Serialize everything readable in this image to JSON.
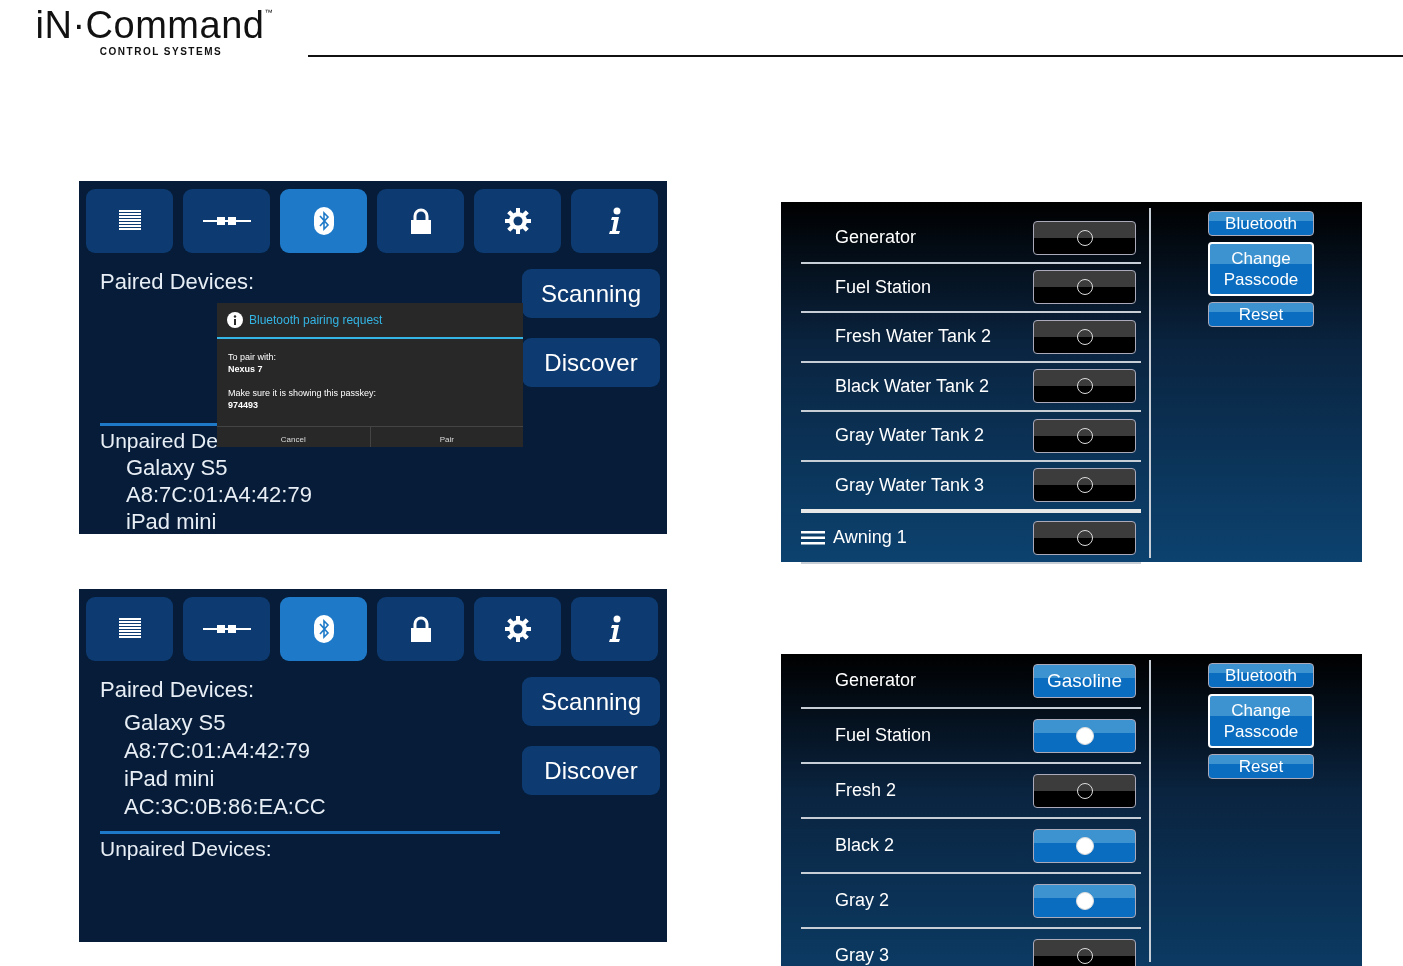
{
  "logo": {
    "wordmark": "iN·Command",
    "trademark": "™",
    "tagline": "CONTROL SYSTEMS"
  },
  "bt_screens": [
    {
      "tabs": [
        {
          "selected": false
        },
        {
          "selected": false
        },
        {
          "selected": true
        },
        {
          "selected": false
        },
        {
          "selected": false
        },
        {
          "selected": false
        }
      ],
      "paired_heading": "Paired Devices:",
      "unpaired_heading": "Unpaired De",
      "unpaired": [
        "Galaxy S5",
        "A8:7C:01:A4:42:79",
        "iPad mini"
      ],
      "buttons": [
        "Scanning",
        "Discover"
      ],
      "dialog": {
        "title": "Bluetooth pairing request",
        "paragraphs": [
          [
            {
              "text": "To pair with:",
              "bold": false
            },
            {
              "text": "Nexus 7",
              "bold": true
            }
          ],
          [
            {
              "text": "Make sure it is showing this passkey:",
              "bold": false
            },
            {
              "text": "974493",
              "bold": true
            }
          ]
        ],
        "buttons": [
          "Cancel",
          "Pair"
        ]
      }
    },
    {
      "tabs": [
        {
          "selected": false
        },
        {
          "selected": false
        },
        {
          "selected": true
        },
        {
          "selected": false
        },
        {
          "selected": false
        },
        {
          "selected": false
        }
      ],
      "paired_heading": "Paired Devices:",
      "paired": [
        "Galaxy S5",
        "A8:7C:01:A4:42:79",
        "iPad mini",
        "AC:3C:0B:86:EA:CC"
      ],
      "unpaired_heading": "Unpaired Devices:",
      "buttons": [
        "Scanning",
        "Discover"
      ]
    }
  ],
  "device_panels": [
    {
      "rows": [
        {
          "label": "Generator",
          "kind": "toggle",
          "on": false
        },
        {
          "label": "Fuel Station",
          "kind": "toggle",
          "on": false
        },
        {
          "label": "Fresh Water Tank 2",
          "kind": "toggle",
          "on": false
        },
        {
          "label": "Black Water Tank 2",
          "kind": "toggle",
          "on": false
        },
        {
          "label": "Gray Water Tank 2",
          "kind": "toggle",
          "on": false
        },
        {
          "label": "Gray Water Tank 3",
          "kind": "toggle",
          "on": false
        },
        {
          "label": "Awning 1",
          "kind": "toggle",
          "on": false,
          "dragging": true
        }
      ],
      "buttons": [
        {
          "label": "Bluetooth",
          "focused": false
        },
        {
          "label": "Change Passcode",
          "focused": true
        },
        {
          "label": "Reset",
          "focused": false
        }
      ]
    },
    {
      "rows": [
        {
          "label": "Generator",
          "kind": "select",
          "value": "Gasoline"
        },
        {
          "label": "Fuel Station",
          "kind": "toggle",
          "on": true
        },
        {
          "label": "Fresh 2",
          "kind": "toggle",
          "on": false
        },
        {
          "label": "Black 2",
          "kind": "toggle",
          "on": true
        },
        {
          "label": "Gray 2",
          "kind": "toggle",
          "on": true
        },
        {
          "label": "Gray 3",
          "kind": "toggle",
          "on": false
        }
      ],
      "buttons": [
        {
          "label": "Bluetooth",
          "focused": false
        },
        {
          "label": "Change Passcode",
          "focused": true
        },
        {
          "label": "Reset",
          "focused": false
        }
      ]
    }
  ]
}
